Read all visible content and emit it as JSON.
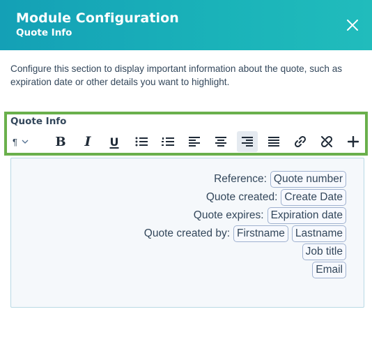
{
  "header": {
    "title": "Module Configuration",
    "subtitle": "Quote Info",
    "close_icon": "close-icon"
  },
  "description": "Configure this section to display important information about the quote, such as expiration date or other details you want to highlight.",
  "editor": {
    "label": "Quote Info",
    "paragraph_symbol": "¶",
    "toolbar": {
      "bold": "B",
      "italic": "I",
      "underline": "U",
      "icons": [
        "bold-icon",
        "italic-icon",
        "underline-icon",
        "bulleted-list-icon",
        "numbered-list-icon",
        "align-left-icon",
        "align-center-icon",
        "align-right-icon",
        "align-justify-icon",
        "link-icon",
        "unlink-icon",
        "plus-icon"
      ],
      "active": "align-right"
    }
  },
  "content": {
    "lines": [
      {
        "label": "Reference:",
        "tokens": [
          "Quote number"
        ]
      },
      {
        "label": "Quote created:",
        "tokens": [
          "Create Date"
        ]
      },
      {
        "label": "Quote expires:",
        "tokens": [
          "Expiration date"
        ]
      },
      {
        "label": "Quote created by:",
        "tokens": [
          "Firstname",
          "Lastname"
        ]
      },
      {
        "label": "",
        "tokens": [
          "Job title"
        ]
      },
      {
        "label": "",
        "tokens": [
          "Email"
        ]
      }
    ]
  },
  "colors": {
    "header_start": "#14a0b6",
    "header_end": "#21bcbc",
    "highlight_border": "#6ab04c",
    "content_bg": "#f5f8fb",
    "token_border": "#9fb1cf"
  }
}
